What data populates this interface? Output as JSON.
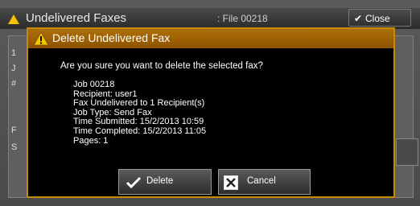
{
  "background": {
    "title": "Undelivered Faxes",
    "file": ": File 00218",
    "close_label": "Close",
    "fragments": [
      "1",
      "J",
      "#",
      "F",
      "S"
    ]
  },
  "dialog": {
    "title": "Delete Undelivered Fax",
    "question": "Are you sure you want to delete the selected fax?",
    "details": [
      "Job 00218",
      "Recipient: user1",
      "Fax Undelivered to 1 Recipient(s)",
      "Job Type: Send Fax",
      "Time Submitted: 15/2/2013 10:59",
      "Time Completed: 15/2/2013 11:05",
      "Pages: 1"
    ],
    "delete_label": "Delete",
    "cancel_label": "Cancel"
  },
  "colors": {
    "accent": "#c58b00",
    "header": "#9a5e03",
    "warning": "#f5c400"
  },
  "icons": {
    "title_warning": "warning-icon",
    "delete": "check-icon",
    "cancel": "x-icon",
    "close": "check-icon"
  }
}
